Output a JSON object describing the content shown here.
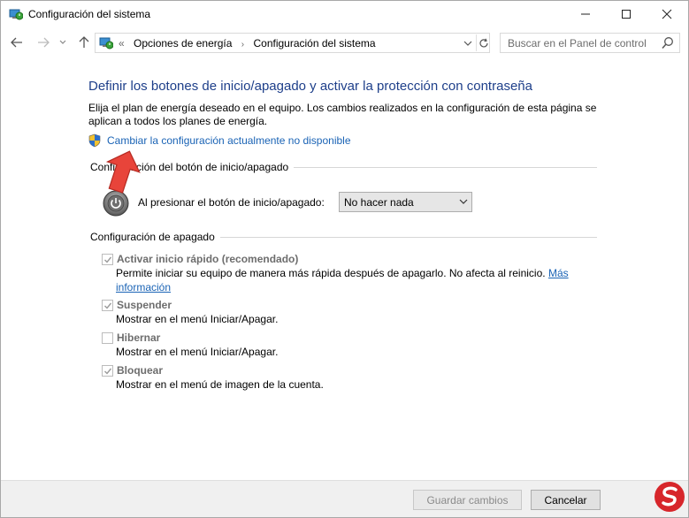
{
  "window": {
    "title": "Configuración del sistema",
    "minimize_label": "—",
    "maximize_label": "☐",
    "close_label": "✕"
  },
  "nav": {
    "back": "←",
    "forward": "→",
    "recent": "⌄",
    "up": "↑",
    "breadcrumb_prefix": "«",
    "breadcrumbs": [
      "Opciones de energía",
      "Configuración del sistema"
    ],
    "breadcrumb_sep": "›",
    "refresh": "↻",
    "search_placeholder": "Buscar en el Panel de control"
  },
  "content": {
    "heading": "Definir los botones de inicio/apagado y activar la protección con contraseña",
    "description": "Elija el plan de energía deseado en el equipo. Los cambios realizados en la configuración de esta página se aplican a todos los planes de energía.",
    "change_link": "Cambiar la configuración actualmente no disponible",
    "power_button_section": "Configuración del botón de inicio/apagado",
    "power_button_label": "Al presionar el botón de inicio/apagado:",
    "power_button_value": "No hacer nada",
    "shutdown_section": "Configuración de apagado",
    "options": [
      {
        "label": "Activar inicio rápido (recomendado)",
        "checked": true,
        "desc": "Permite iniciar su equipo de manera más rápida después de apagarlo. No afecta al reinicio.",
        "link_part1": "Más",
        "link_part2": "información"
      },
      {
        "label": "Suspender",
        "checked": true,
        "desc": "Mostrar en el menú Iniciar/Apagar."
      },
      {
        "label": "Hibernar",
        "checked": false,
        "desc": "Mostrar en el menú Iniciar/Apagar."
      },
      {
        "label": "Bloquear",
        "checked": true,
        "desc": "Mostrar en el menú de imagen de la cuenta."
      }
    ]
  },
  "footer": {
    "save_label": "Guardar cambios",
    "cancel_label": "Cancelar"
  },
  "colors": {
    "heading": "#1e3f8a",
    "link": "#1a63b5",
    "annotation_arrow": "#e8443a"
  }
}
